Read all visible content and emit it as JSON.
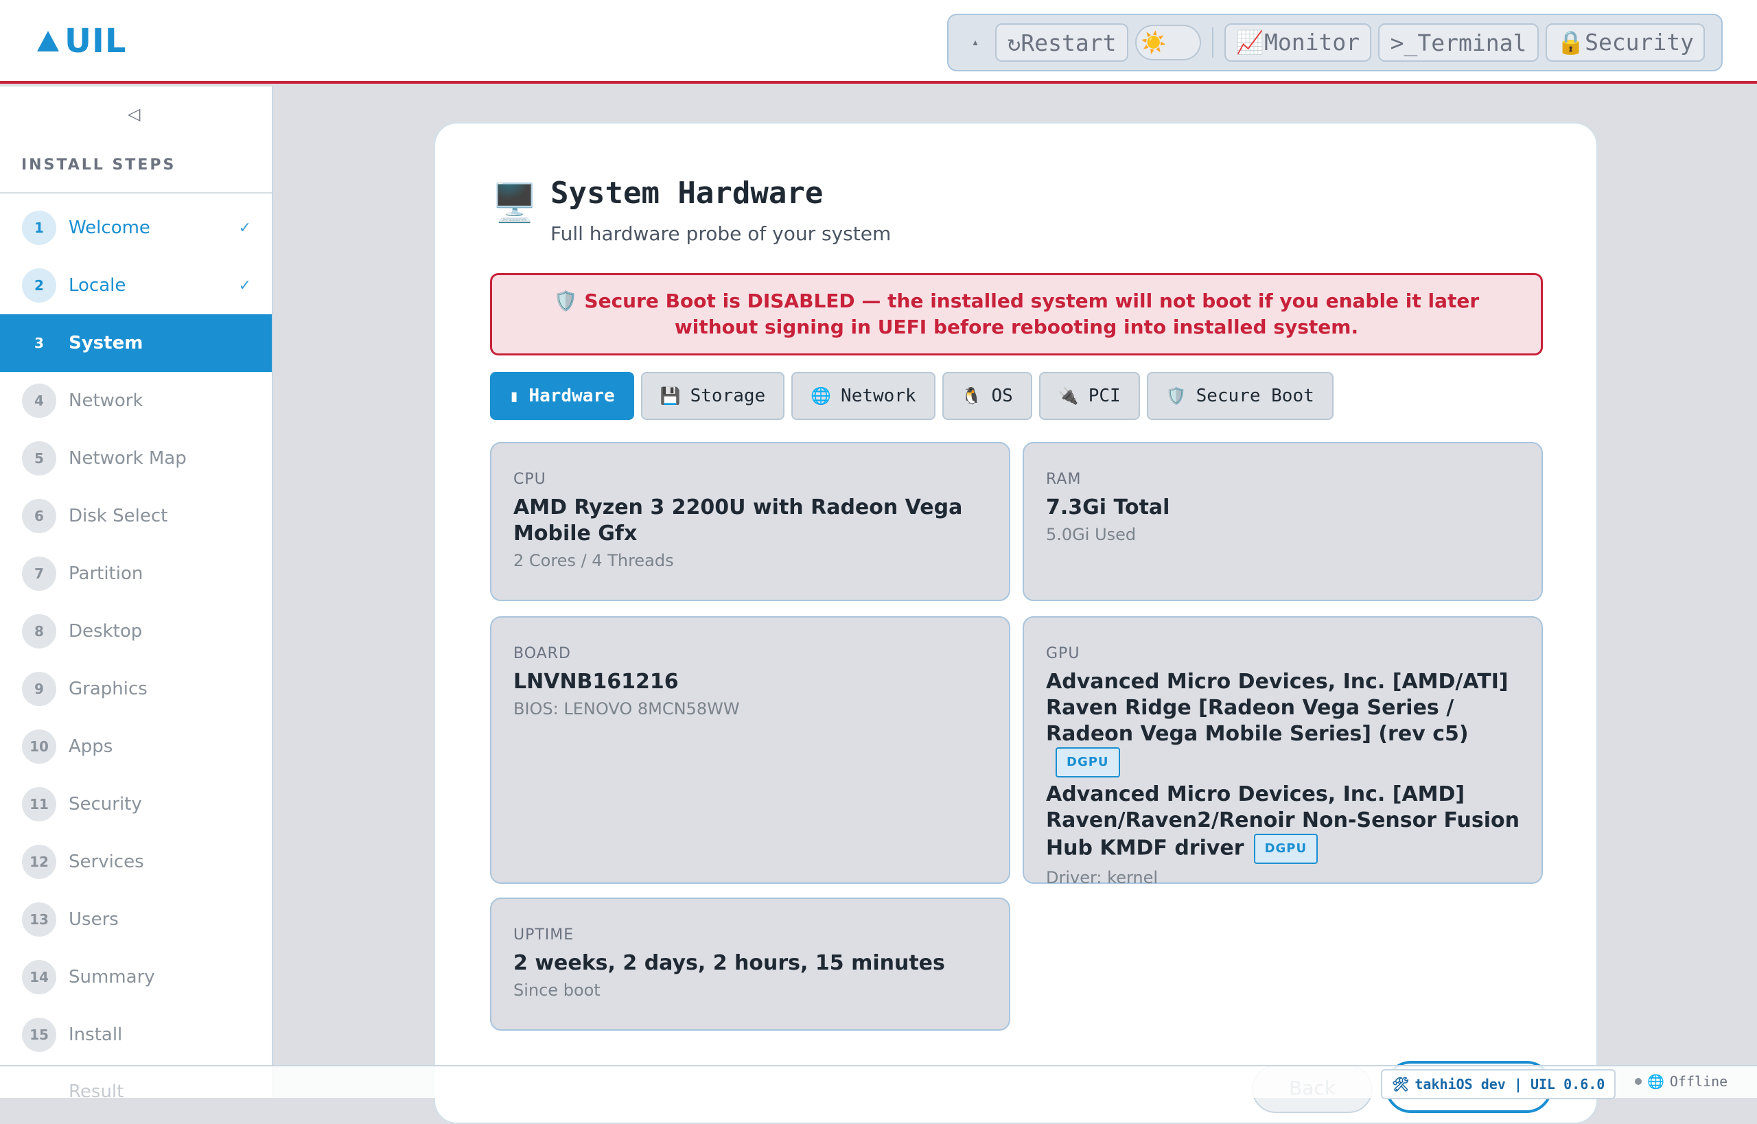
{
  "header": {
    "logo_text": "UIL",
    "toolbar": {
      "collapse_glyph": "▴",
      "restart_label": "↻Restart",
      "theme_glyph": "☀️",
      "monitor_label": "📈Monitor",
      "terminal_label": ">_Terminal",
      "security_label": "🔒Security"
    }
  },
  "sidebar": {
    "collapse_glyph": "◁",
    "title": "INSTALL STEPS",
    "check_glyph": "✓",
    "items": [
      {
        "num": "1",
        "label": "Welcome",
        "state": "done"
      },
      {
        "num": "2",
        "label": "Locale",
        "state": "done"
      },
      {
        "num": "3",
        "label": "System",
        "state": "active"
      },
      {
        "num": "4",
        "label": "Network",
        "state": "pending"
      },
      {
        "num": "5",
        "label": "Network Map",
        "state": "pending"
      },
      {
        "num": "6",
        "label": "Disk Select",
        "state": "pending"
      },
      {
        "num": "7",
        "label": "Partition",
        "state": "pending"
      },
      {
        "num": "8",
        "label": "Desktop",
        "state": "pending"
      },
      {
        "num": "9",
        "label": "Graphics",
        "state": "pending"
      },
      {
        "num": "10",
        "label": "Apps",
        "state": "pending"
      },
      {
        "num": "11",
        "label": "Security",
        "state": "pending"
      },
      {
        "num": "12",
        "label": "Services",
        "state": "pending"
      },
      {
        "num": "13",
        "label": "Users",
        "state": "pending"
      },
      {
        "num": "14",
        "label": "Summary",
        "state": "pending"
      },
      {
        "num": "15",
        "label": "Install",
        "state": "pending"
      }
    ],
    "partial_item_label": "Result"
  },
  "main": {
    "icon": "🖥️",
    "title": "System Hardware",
    "subtitle": "Full hardware probe of your system",
    "alert": "🛡️ Secure Boot is DISABLED — the installed system will not boot if you enable it later without signing in UEFI before rebooting into installed system.",
    "tabs": [
      {
        "icon": "▮",
        "label": "Hardware",
        "active": true
      },
      {
        "icon": "💾",
        "label": "Storage",
        "active": false
      },
      {
        "icon": "🌐",
        "label": "Network",
        "active": false
      },
      {
        "icon": "🐧",
        "label": "OS",
        "active": false
      },
      {
        "icon": "🔌",
        "label": "PCI",
        "active": false
      },
      {
        "icon": "🛡️",
        "label": "Secure Boot",
        "active": false
      }
    ],
    "cpu": {
      "label": "CPU",
      "value": "AMD Ryzen 3 2200U with Radeon Vega Mobile Gfx",
      "sub": "2 Cores / 4 Threads"
    },
    "ram": {
      "label": "RAM",
      "value": "7.3Gi Total",
      "sub": "5.0Gi Used"
    },
    "board": {
      "label": "BOARD",
      "value": "LNVNB161216",
      "sub": "BIOS: LENOVO 8MCN58WW"
    },
    "gpu": {
      "label": "GPU",
      "devices": [
        {
          "name": "Advanced Micro Devices, Inc. [AMD/ATI] Raven Ridge [Radeon Vega Series / Radeon Vega Mobile Series] (rev c5)",
          "badge": "DGPU"
        },
        {
          "name": "Advanced Micro Devices, Inc. [AMD] Raven/Raven2/Renoir Non-Sensor Fusion Hub KMDF driver",
          "badge": "DGPU"
        }
      ],
      "sub": "Driver: kernel"
    },
    "uptime": {
      "label": "UPTIME",
      "value": "2 weeks, 2 days, 2 hours, 15 minutes",
      "sub": "Since boot"
    },
    "back_label": "Back"
  },
  "statusbar": {
    "version_icon": "🛠",
    "version_text": "takhiOS dev | UIL 0.6.0",
    "net_icon": "🌐",
    "net_status": "Offline"
  }
}
